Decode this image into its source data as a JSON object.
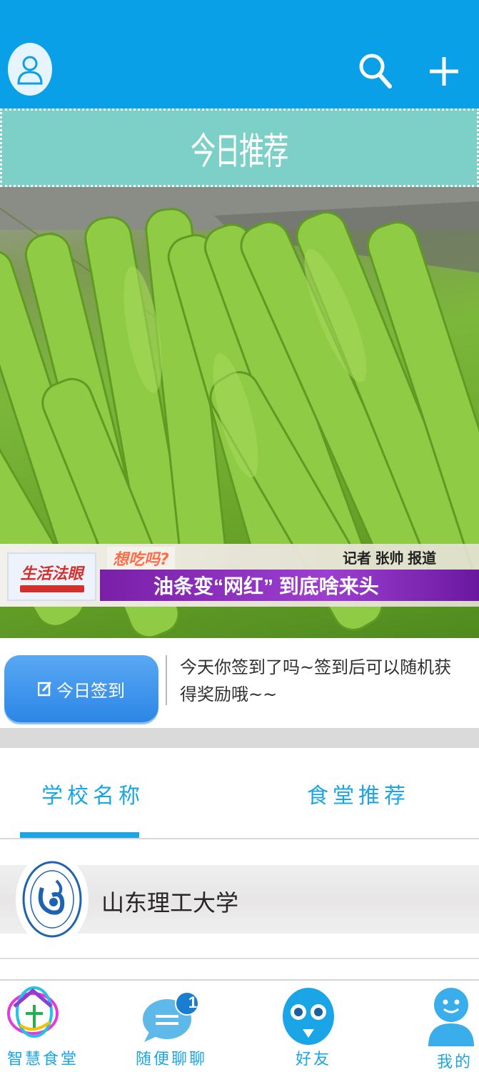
{
  "header": {
    "avatar_icon": "user-avatar-icon",
    "search_icon": "search-icon",
    "add_icon": "plus-icon",
    "background_color": "#0aa0e8"
  },
  "banner": {
    "title": "今日推荐",
    "background_color": "#7cd0c8"
  },
  "featured_image": {
    "tv_logo": "生活法眼",
    "tv_tag": "想吃吗?",
    "reporter": "记者 张帅 报道",
    "headline": "油条变“网红” 到底啥来头"
  },
  "signin": {
    "button_label": "今日签到",
    "button_icon": "edit-icon",
    "description": "今天你签到了吗~签到后可以随机获得奖励哦~~"
  },
  "tabs": [
    {
      "label": "学校名称",
      "active": true
    },
    {
      "label": "食堂推荐",
      "active": false
    }
  ],
  "schools": [
    {
      "name": "山东理工大学",
      "logo_icon": "university-seal-icon"
    }
  ],
  "bottom_nav": [
    {
      "label": "智慧食堂",
      "icon": "canteen-logo-icon"
    },
    {
      "label": "随便聊聊",
      "icon": "chat-bubble-icon",
      "badge": "1"
    },
    {
      "label": "好友",
      "icon": "friends-face-icon"
    },
    {
      "label": "我的",
      "icon": "profile-person-icon"
    }
  ],
  "accent_color": "#1aa5e6"
}
